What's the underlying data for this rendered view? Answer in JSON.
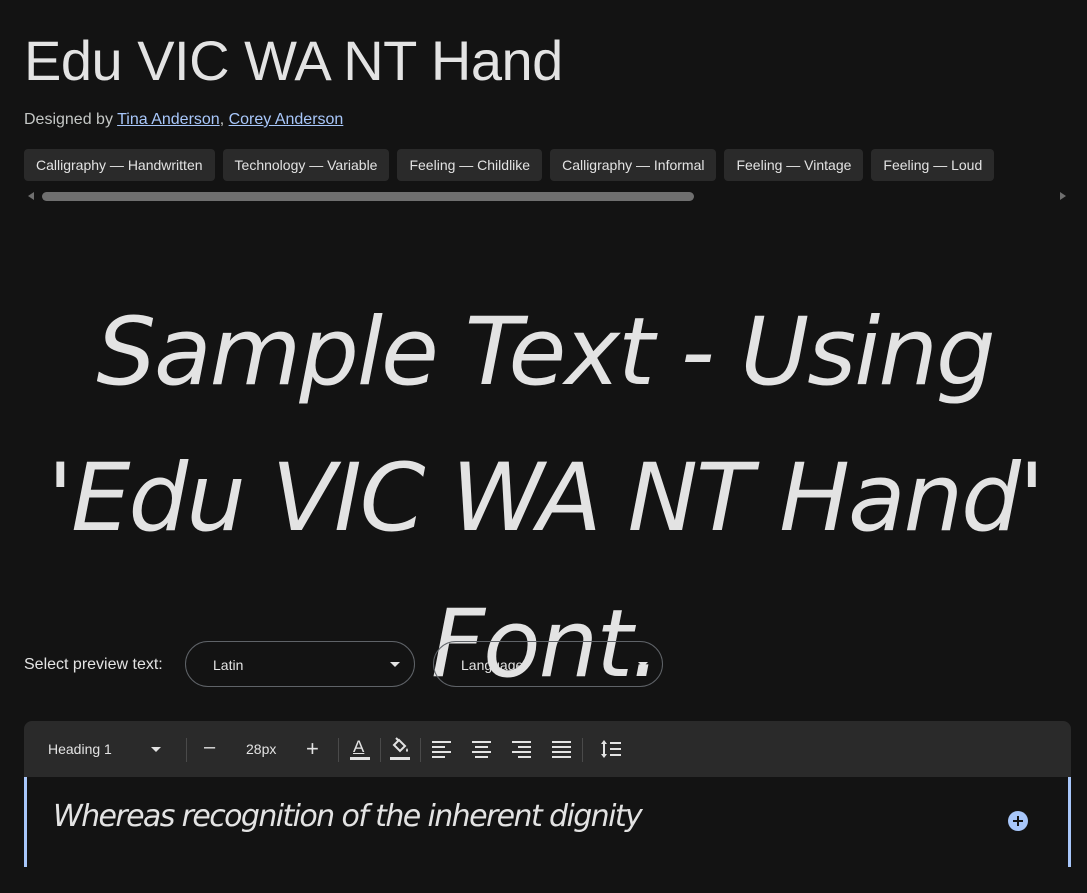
{
  "header": {
    "title": "Edu VIC WA NT Hand",
    "designed_by_prefix": "Designed by ",
    "designers": [
      "Tina Anderson",
      "Corey Anderson"
    ],
    "separator": ", "
  },
  "tags": [
    "Calligraphy — Handwritten",
    "Technology — Variable",
    "Feeling — Childlike",
    "Calligraphy — Informal",
    "Feeling — Vintage",
    "Feeling — Loud"
  ],
  "sample": {
    "text": "Sample Text - Using 'Edu VIC WA NT Hand' Font."
  },
  "preview_controls": {
    "label": "Select preview text:",
    "script_select": "Latin",
    "language_select": "Language"
  },
  "toolbar": {
    "style_select": "Heading 1",
    "decrease_label": "–",
    "font_size": "28px",
    "increase_label": "+",
    "text_color_letter": "A"
  },
  "editor": {
    "text": "Whereas recognition of the inherent dignity"
  },
  "colors": {
    "background": "#131313",
    "accent": "#a8c7fa",
    "chip_bg": "#2a2a2a",
    "toolbar_bg": "#2a2a2a"
  }
}
